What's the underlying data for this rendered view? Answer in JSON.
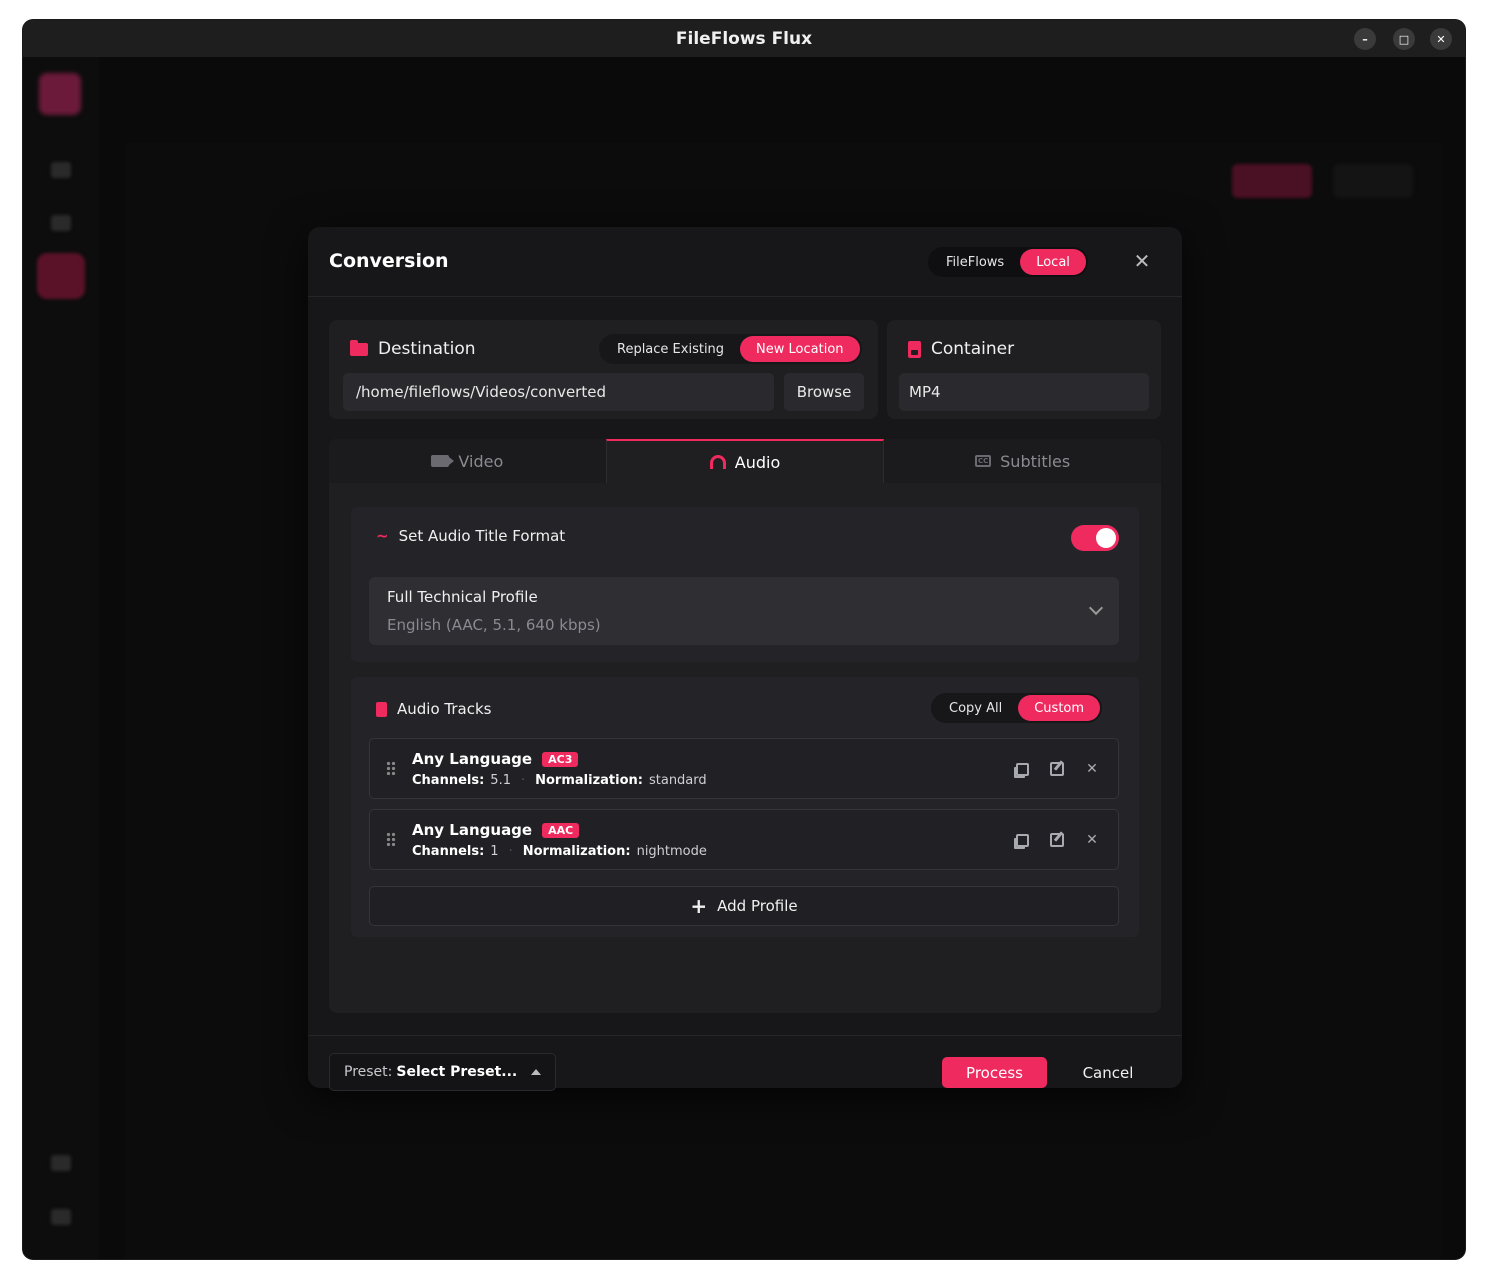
{
  "window": {
    "title": "FileFlows Flux",
    "min": "–",
    "max": "□",
    "close": "✕"
  },
  "modal": {
    "title": "Conversion",
    "mode_options": [
      "FileFlows",
      "Local"
    ],
    "close": "✕",
    "destination": {
      "label": "Destination",
      "options": [
        "Replace Existing",
        "New Location"
      ],
      "path": "/home/fileflows/Videos/converted",
      "browse": "Browse"
    },
    "container": {
      "label": "Container",
      "value": "MP4"
    },
    "tabs": [
      "Video",
      "Audio",
      "Subtitles"
    ],
    "audio": {
      "title_format_label": "Set Audio Title Format",
      "title_format_enabled": true,
      "profile_name": "Full Technical Profile",
      "profile_preview": "English (AAC, 5.1, 640 kbps)",
      "tracks_label": "Audio Tracks",
      "tracks_options": [
        "Copy All",
        "Custom"
      ],
      "tracks": [
        {
          "language": "Any Language",
          "codec": "AC3",
          "channels_label": "Channels:",
          "channels": "5.1",
          "norm_label": "Normalization:",
          "norm": "standard"
        },
        {
          "language": "Any Language",
          "codec": "AAC",
          "channels_label": "Channels:",
          "channels": "1",
          "norm_label": "Normalization:",
          "norm": "nightmode"
        }
      ],
      "add_profile": "Add Profile"
    },
    "footer": {
      "preset_label": "Preset:",
      "preset_value": "Select Preset...",
      "process": "Process",
      "cancel": "Cancel"
    }
  },
  "colors": {
    "accent": "#ef2a5f",
    "modal_bg": "#171719",
    "card_bg": "#1f1f22"
  }
}
